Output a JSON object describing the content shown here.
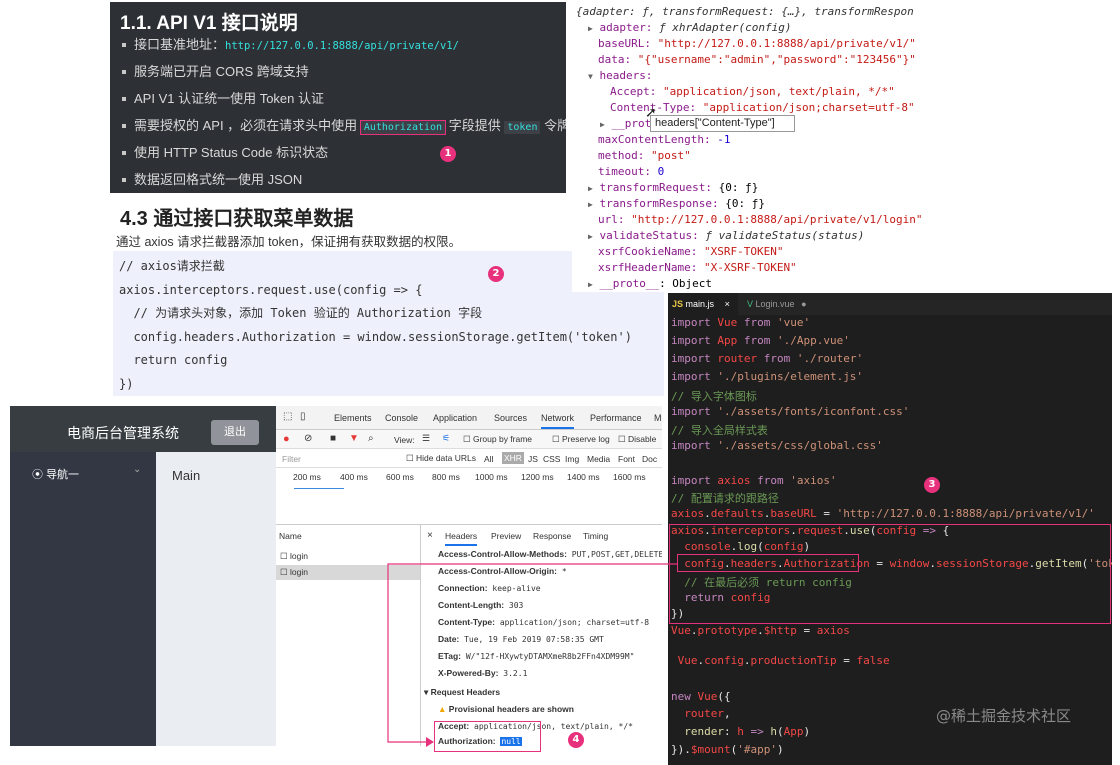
{
  "doc": {
    "heading": "1.1. API V1 接口说明",
    "items": [
      {
        "text": "接口基准地址：",
        "code": "http://127.0.0.1:8888/api/private/v1/"
      },
      {
        "text": "服务端已开启 CORS 跨域支持"
      },
      {
        "text": "API V1 认证统一使用 Token 认证"
      },
      {
        "pre": "需要授权的 API ，必须在请求头中使用",
        "code1": "Authorization",
        "mid": "字段提供",
        "code2": "token",
        "post": "令牌"
      },
      {
        "text": "使用 HTTP Status Code 标识状态"
      },
      {
        "text": "数据返回格式统一使用 JSON"
      }
    ],
    "section_title": "4.3 通过接口获取菜单数据",
    "section_desc": "通过 axios 请求拦截器添加 token，保证拥有获取数据的权限。",
    "code_lines": [
      "// axios请求拦截",
      "axios.interceptors.request.use(config => {",
      "  // 为请求头对象，添加 Token 验证的 Authorization 字段",
      "  config.headers.Authorization = window.sessionStorage.getItem('token')",
      "  return config",
      "})"
    ]
  },
  "badges": [
    "1",
    "2",
    "3",
    "4"
  ],
  "console": {
    "l0": "{adapter: ƒ, transformRequest: {…}, transformRespon",
    "adapter_key": "adapter:",
    "adapter_val": "ƒ xhrAdapter(config)",
    "baseURL_key": "baseURL:",
    "baseURL_val": "\"http://127.0.0.1:8888/api/private/v1/\"",
    "data_key": "data:",
    "data_val": "\"{\"username\":\"admin\",\"password\":\"123456\"}\"",
    "headers_key": "headers:",
    "accept_key": "Accept:",
    "accept_val": "\"application/json, text/plain, */*\"",
    "ct_key": "Content-Type:",
    "ct_val": "\"application/json;charset=utf-8\"",
    "proto1": "__proto__",
    "maxlen_key": "maxContentLength:",
    "maxlen_val": "-1",
    "method_key": "method:",
    "method_val": "\"post\"",
    "timeout_key": "timeout:",
    "timeout_val": "0",
    "treq_key": "transformRequest:",
    "treq_val": "{0: ƒ}",
    "tres_key": "transformResponse:",
    "tres_val": "{0: ƒ}",
    "url_key": "url:",
    "url_val": "\"http://127.0.0.1:8888/api/private/v1/login\"",
    "vs_key": "validateStatus:",
    "vs_val": "ƒ validateStatus(status)",
    "xc_key": "xsrfCookieName:",
    "xc_val": "\"XSRF-TOKEN\"",
    "xh_key": "xsrfHeaderName:",
    "xh_val": "\"X-XSRF-TOKEN\"",
    "proto2": "__proto__",
    "proto2_val": ": Object",
    "tooltip": "headers[\"Content-Type\"]"
  },
  "app": {
    "title": "电商后台管理系统",
    "logout": "退出",
    "nav": "导航一",
    "main": "Main"
  },
  "devtools": {
    "tabs": [
      "Elements",
      "Console",
      "Application",
      "Sources",
      "Network",
      "Performance",
      "M"
    ],
    "view_label": "View:",
    "group_by_frame": "Group by frame",
    "preserve_log": "Preserve log",
    "disable": "Disable",
    "filter_placeholder": "Filter",
    "hide_data_urls": "Hide data URLs",
    "types": [
      "All",
      "XHR",
      "JS",
      "CSS",
      "Img",
      "Media",
      "Font",
      "Doc"
    ],
    "timeline": [
      "200 ms",
      "400 ms",
      "600 ms",
      "800 ms",
      "1000 ms",
      "1200 ms",
      "1400 ms",
      "1600 ms"
    ],
    "name_col": "Name",
    "requests": [
      "login",
      "login"
    ],
    "detail_tabs": [
      "Headers",
      "Preview",
      "Response",
      "Timing"
    ],
    "headers": [
      {
        "k": "Access-Control-Allow-Methods:",
        "v": "PUT,POST,GET,DELETE"
      },
      {
        "k": "Access-Control-Allow-Origin:",
        "v": "*"
      },
      {
        "k": "Connection:",
        "v": "keep-alive"
      },
      {
        "k": "Content-Length:",
        "v": "303"
      },
      {
        "k": "Content-Type:",
        "v": "application/json; charset=utf-8"
      },
      {
        "k": "Date:",
        "v": "Tue, 19 Feb 2019 07:58:35 GMT"
      },
      {
        "k": "ETag:",
        "v": "W/\"12f-HXywtyDTAMXmeR8b2FFn4XDM99M\""
      },
      {
        "k": "X-Powered-By:",
        "v": "3.2.1"
      }
    ],
    "request_headers": "Request Headers",
    "provisional": "Provisional headers are shown",
    "req_accept_k": "Accept:",
    "req_accept_v": "application/json, text/plain, */*",
    "auth_k": "Authorization:",
    "auth_v": "null"
  },
  "vscode": {
    "tab1": "main.js",
    "tab2": "Login.vue",
    "lines": [
      {
        "parts": [
          [
            "vk",
            "import "
          ],
          [
            "vr",
            "Vue"
          ],
          [
            "vk",
            " from "
          ],
          [
            "vs",
            "'vue'"
          ]
        ]
      },
      {
        "parts": [
          [
            "vk",
            "import "
          ],
          [
            "vr",
            "App"
          ],
          [
            "vk",
            " from "
          ],
          [
            "vs",
            "'./App.vue'"
          ]
        ]
      },
      {
        "parts": [
          [
            "vk",
            "import "
          ],
          [
            "vr",
            "router"
          ],
          [
            "vk",
            " from "
          ],
          [
            "vs",
            "'./router'"
          ]
        ]
      },
      {
        "parts": [
          [
            "vk",
            "import "
          ],
          [
            "vs",
            "'./plugins/element.js'"
          ]
        ]
      },
      {
        "parts": [
          [
            "vc",
            "// 导入字体图标"
          ]
        ]
      },
      {
        "parts": [
          [
            "vk",
            "import "
          ],
          [
            "vs",
            "'./assets/fonts/iconfont.css'"
          ]
        ]
      },
      {
        "parts": [
          [
            "vc",
            "// 导入全局样式表"
          ]
        ]
      },
      {
        "parts": [
          [
            "vk",
            "import "
          ],
          [
            "vs",
            "'./assets/css/global.css'"
          ]
        ]
      },
      {
        "parts": [
          [
            "vw",
            " "
          ]
        ]
      },
      {
        "parts": [
          [
            "vk",
            "import "
          ],
          [
            "vr",
            "axios"
          ],
          [
            "vk",
            " from "
          ],
          [
            "vs",
            "'axios'"
          ]
        ]
      },
      {
        "parts": [
          [
            "vc",
            "// 配置请求的跟路径"
          ]
        ]
      },
      {
        "parts": [
          [
            "vr",
            "axios"
          ],
          [
            "vw",
            "."
          ],
          [
            "vr",
            "defaults"
          ],
          [
            "vw",
            "."
          ],
          [
            "vr",
            "baseURL"
          ],
          [
            "vw",
            " = "
          ],
          [
            "vs",
            "'http://127.0.0.1:8888/api/private/v1/'"
          ]
        ]
      },
      {
        "parts": [
          [
            "vr",
            "axios"
          ],
          [
            "vw",
            "."
          ],
          [
            "vr",
            "interceptors"
          ],
          [
            "vw",
            "."
          ],
          [
            "vr",
            "request"
          ],
          [
            "vw",
            "."
          ],
          [
            "vy",
            "use"
          ],
          [
            "vw",
            "("
          ],
          [
            "vr",
            "config"
          ],
          [
            "vk",
            " => "
          ],
          [
            "vw",
            "{"
          ]
        ]
      },
      {
        "parts": [
          [
            "vw",
            "  "
          ],
          [
            "vr",
            "console"
          ],
          [
            "vw",
            "."
          ],
          [
            "vy",
            "log"
          ],
          [
            "vw",
            "("
          ],
          [
            "vr",
            "config"
          ],
          [
            "vw",
            ")"
          ]
        ]
      },
      {
        "parts": [
          [
            "vw",
            "  "
          ],
          [
            "vr",
            "config"
          ],
          [
            "vw",
            "."
          ],
          [
            "vr",
            "headers"
          ],
          [
            "vw",
            "."
          ],
          [
            "vr",
            "Authorization"
          ],
          [
            "vw",
            " = "
          ],
          [
            "vr",
            "window"
          ],
          [
            "vw",
            "."
          ],
          [
            "vr",
            "sessionStorage"
          ],
          [
            "vw",
            "."
          ],
          [
            "vy",
            "getItem"
          ],
          [
            "vw",
            "("
          ],
          [
            "vs",
            "'token'"
          ],
          [
            "vw",
            ")"
          ]
        ]
      },
      {
        "parts": [
          [
            "vc",
            "  // 在最后必须 return config"
          ]
        ]
      },
      {
        "parts": [
          [
            "vk",
            "  return "
          ],
          [
            "vr",
            "config"
          ]
        ]
      },
      {
        "parts": [
          [
            "vw",
            "})"
          ]
        ]
      },
      {
        "parts": [
          [
            "vr",
            "Vue"
          ],
          [
            "vw",
            "."
          ],
          [
            "vr",
            "prototype"
          ],
          [
            "vw",
            "."
          ],
          [
            "vr",
            "$http"
          ],
          [
            "vw",
            " = "
          ],
          [
            "vr",
            "axios"
          ]
        ]
      },
      {
        "parts": [
          [
            "vw",
            " "
          ]
        ]
      },
      {
        "parts": [
          [
            "vr",
            " Vue"
          ],
          [
            "vw",
            "."
          ],
          [
            "vr",
            "config"
          ],
          [
            "vw",
            "."
          ],
          [
            "vr",
            "productionTip"
          ],
          [
            "vw",
            " = "
          ],
          [
            "vr",
            "false"
          ]
        ]
      },
      {
        "parts": [
          [
            "vw",
            " "
          ]
        ]
      },
      {
        "parts": [
          [
            "vk",
            "new "
          ],
          [
            "vr",
            "Vue"
          ],
          [
            "vw",
            "({"
          ]
        ]
      },
      {
        "parts": [
          [
            "vw",
            "  "
          ],
          [
            "vr",
            "router"
          ],
          [
            "vw",
            ","
          ]
        ]
      },
      {
        "parts": [
          [
            "vw",
            "  "
          ],
          [
            "vy",
            "render"
          ],
          [
            "vw",
            ": "
          ],
          [
            "vr",
            "h"
          ],
          [
            "vk",
            " => "
          ],
          [
            "vy",
            "h"
          ],
          [
            "vw",
            "("
          ],
          [
            "vr",
            "App"
          ],
          [
            "vw",
            ")"
          ]
        ]
      },
      {
        "parts": [
          [
            "vw",
            "})."
          ],
          [
            "vr",
            "$mount"
          ],
          [
            "vw",
            "("
          ],
          [
            "vs",
            "'#app'"
          ],
          [
            "vw",
            ")"
          ]
        ]
      }
    ]
  },
  "watermark": "@稀土掘金技术社区",
  "colors": {
    "accent": "#e8317c",
    "cyan": "#34e0de",
    "vscode_bg": "#1e1e1e"
  }
}
